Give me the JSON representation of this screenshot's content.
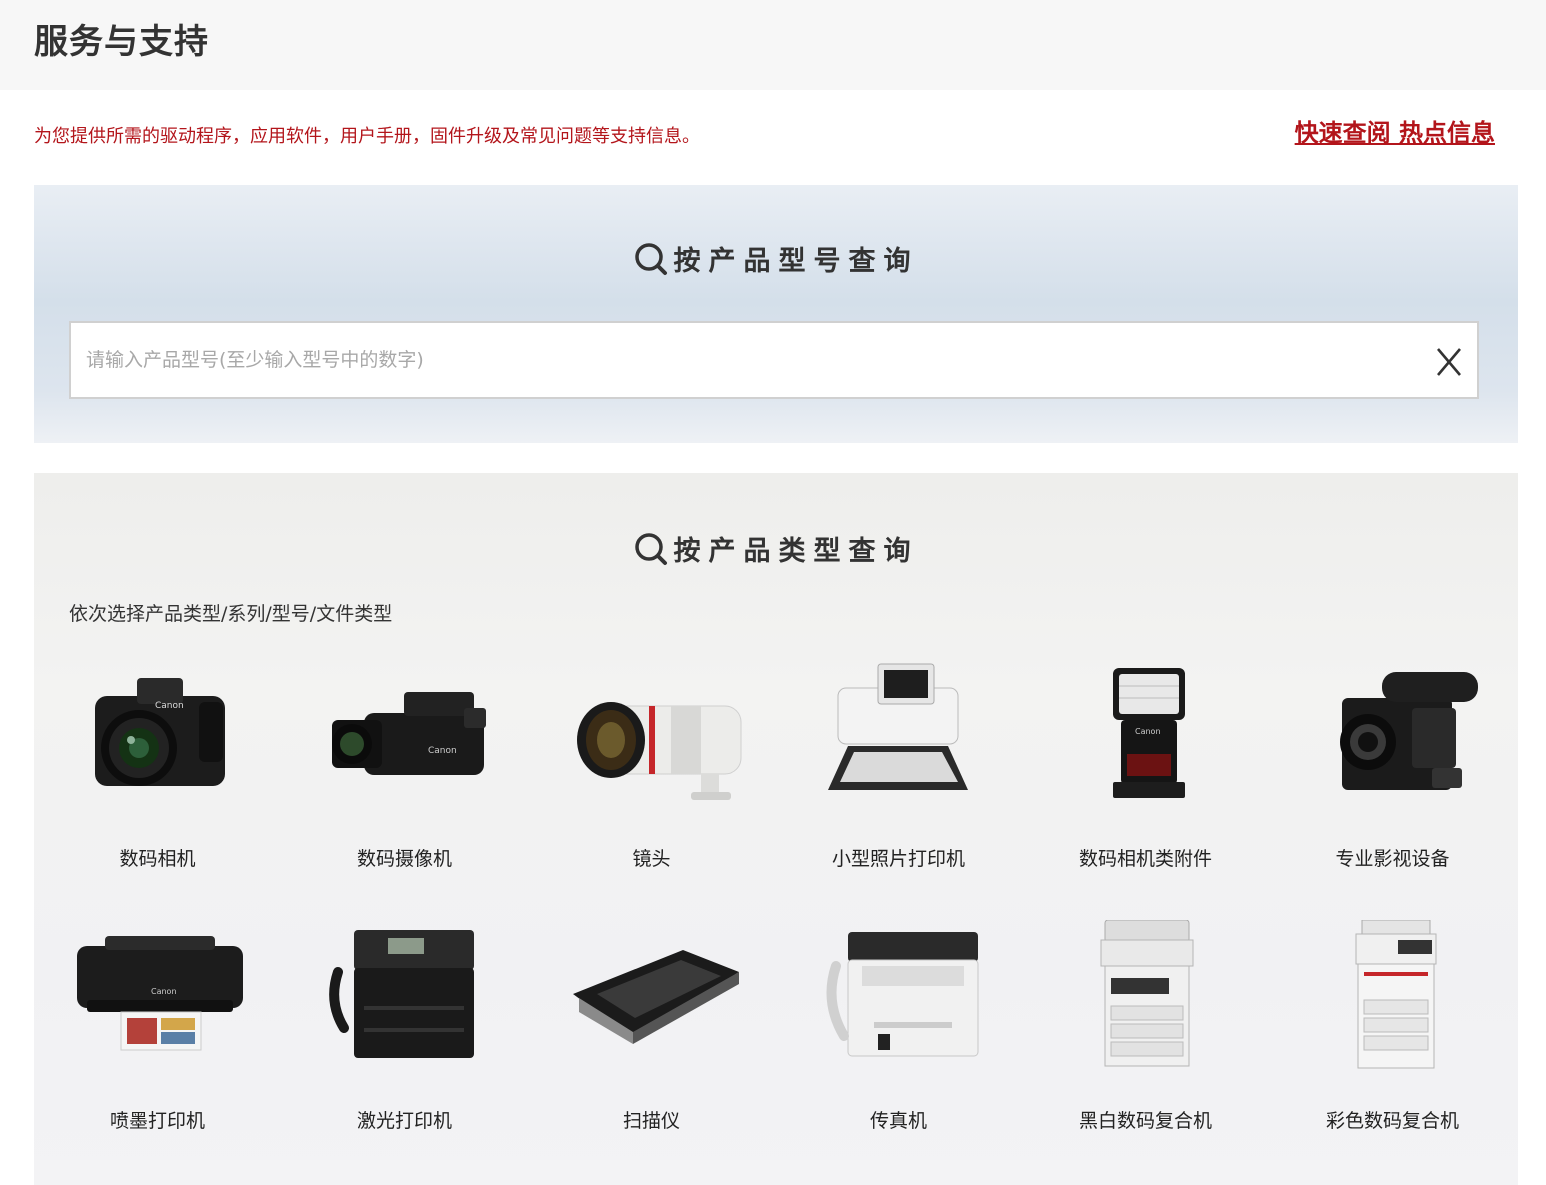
{
  "header": {
    "title": "服务与支持"
  },
  "intro": {
    "text": "为您提供所需的驱动程序，应用软件，用户手册，固件升级及常见问题等支持信息。",
    "hot_link": "快速查阅 热点信息"
  },
  "model_search": {
    "heading": "按产品型号查询",
    "placeholder": "请输入产品型号(至少输入型号中的数字)",
    "clear_label": "X"
  },
  "type_search": {
    "heading": "按产品类型查询",
    "hint": "依次选择产品类型/系列/型号/文件类型",
    "categories": [
      {
        "label": "数码相机",
        "icon": "dslr-camera-icon"
      },
      {
        "label": "数码摄像机",
        "icon": "camcorder-icon"
      },
      {
        "label": "镜头",
        "icon": "lens-icon"
      },
      {
        "label": "小型照片打印机",
        "icon": "photo-printer-icon"
      },
      {
        "label": "数码相机类附件",
        "icon": "speedlite-flash-icon"
      },
      {
        "label": "专业影视设备",
        "icon": "cinema-camera-icon"
      },
      {
        "label": "喷墨打印机",
        "icon": "inkjet-printer-icon"
      },
      {
        "label": "激光打印机",
        "icon": "laser-printer-icon"
      },
      {
        "label": "扫描仪",
        "icon": "scanner-icon"
      },
      {
        "label": "传真机",
        "icon": "fax-machine-icon"
      },
      {
        "label": "黑白数码复合机",
        "icon": "mono-mfp-icon"
      },
      {
        "label": "彩色数码复合机",
        "icon": "color-mfp-icon"
      }
    ]
  },
  "colors": {
    "accent": "#b3151b",
    "heading": "#333333"
  }
}
